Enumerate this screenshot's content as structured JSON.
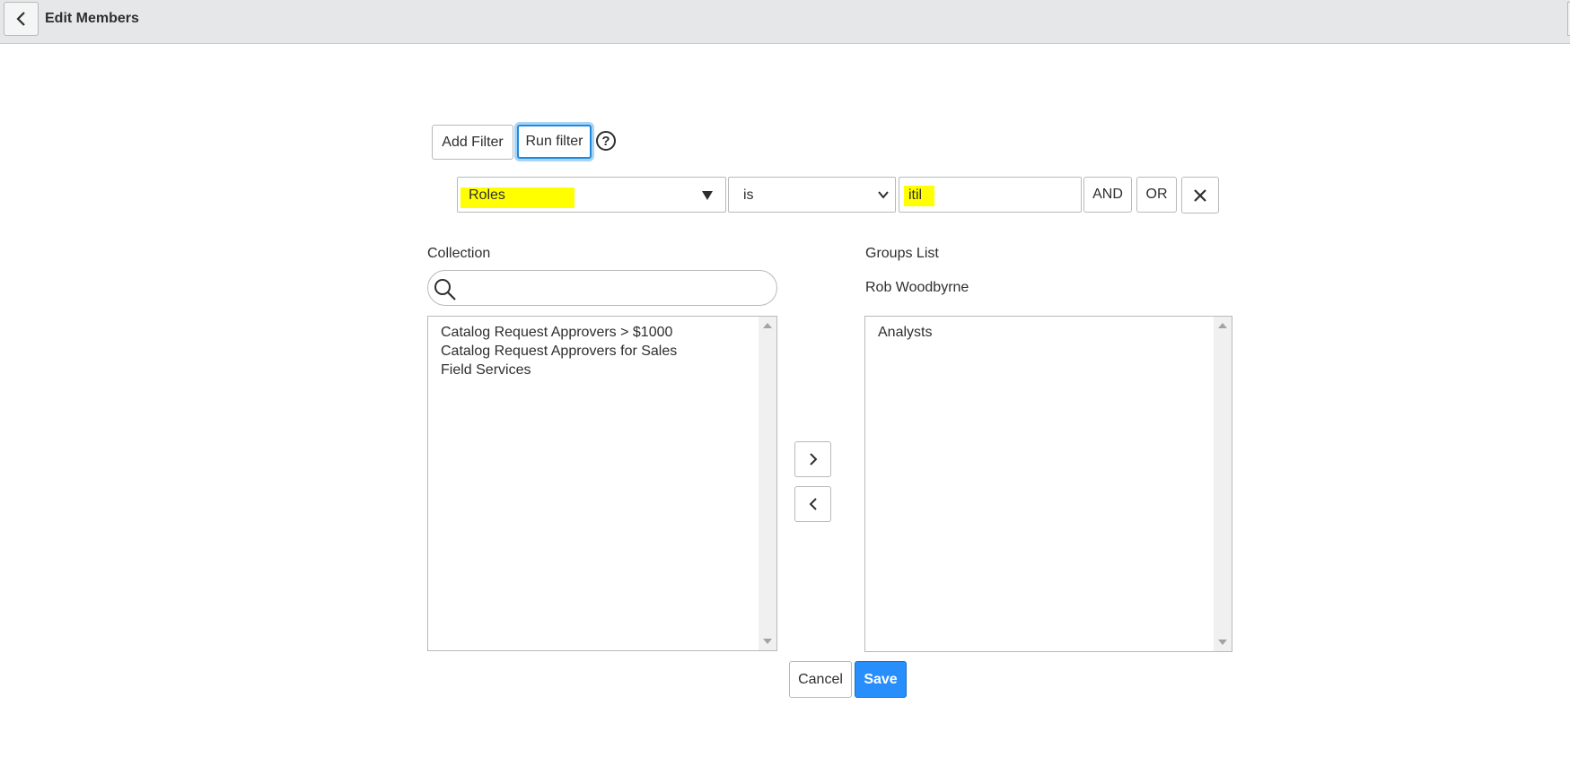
{
  "header": {
    "title": "Edit Members",
    "back_icon": "chevron-left-icon"
  },
  "filter": {
    "add_filter_label": "Add Filter",
    "run_filter_label": "Run filter",
    "help_icon": "question-circle-icon",
    "help_glyph": "?",
    "field_value": "Roles",
    "operator_value": "is",
    "input_value": "itil",
    "and_label": "AND",
    "or_label": "OR",
    "remove_icon": "close-icon"
  },
  "collection": {
    "title": "Collection",
    "search_icon": "search-icon",
    "search_value": "",
    "items": [
      "Catalog Request Approvers > $1000",
      "Catalog Request Approvers for Sales",
      "Field Services"
    ]
  },
  "groups": {
    "title": "Groups List",
    "subtitle": "Rob Woodbyrne",
    "items": [
      "Analysts"
    ]
  },
  "actions": {
    "add_icon": "chevron-right-icon",
    "remove_icon": "chevron-left-icon",
    "cancel_label": "Cancel",
    "save_label": "Save"
  },
  "colors": {
    "highlight": "#ffff00",
    "primary": "#278efc",
    "focus_ring": "#1f8ae0",
    "header_bg": "#e6e7e8"
  }
}
